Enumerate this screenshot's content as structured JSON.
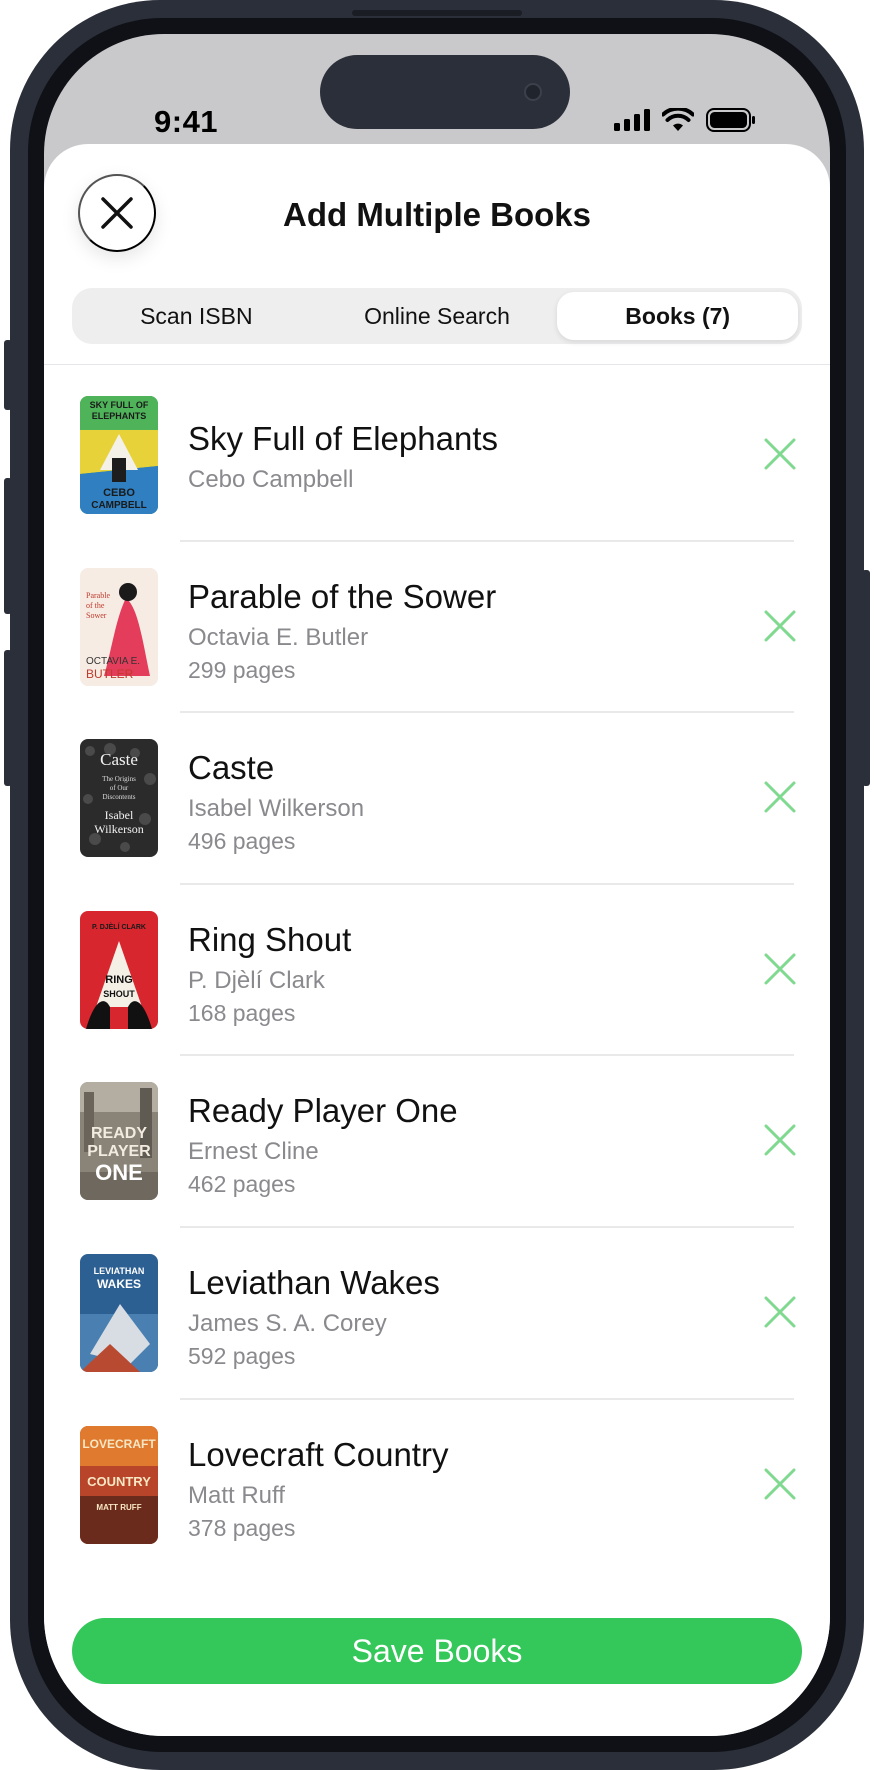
{
  "status_bar": {
    "time": "9:41"
  },
  "sheet": {
    "title": "Add Multiple Books",
    "close_icon": "close-icon"
  },
  "tabs": [
    {
      "label": "Scan ISBN",
      "active": false
    },
    {
      "label": "Online Search",
      "active": false
    },
    {
      "label": "Books (7)",
      "active": true
    }
  ],
  "books": [
    {
      "title": "Sky Full of Elephants",
      "author": "Cebo Campbell",
      "pages": "",
      "cover_text": [
        "SKY FULL OF",
        "ELEPHANTS",
        "CEBO",
        "CAMPBELL"
      ]
    },
    {
      "title": "Parable of the Sower",
      "author": "Octavia E. Butler",
      "pages": "299 pages",
      "cover_text": [
        "Parable",
        "of the",
        "Sower",
        "OCTAVIA E.",
        "BUTLER"
      ]
    },
    {
      "title": "Caste",
      "author": "Isabel Wilkerson",
      "pages": "496 pages",
      "cover_text": [
        "Caste",
        "The Origins",
        "of Our",
        "Discontents",
        "Isabel",
        "Wilkerson"
      ]
    },
    {
      "title": "Ring Shout",
      "author": "P. Djèlí Clark",
      "pages": "168 pages",
      "cover_text": [
        "P. DJÈLÍ CLARK",
        "RING",
        "SHOUT"
      ]
    },
    {
      "title": "Ready Player One",
      "author": "Ernest Cline",
      "pages": "462 pages",
      "cover_text": [
        "READY",
        "PLAYER",
        "ONE"
      ]
    },
    {
      "title": "Leviathan Wakes",
      "author": "James S. A. Corey",
      "pages": "592 pages",
      "cover_text": [
        "LEVIATHAN",
        "WAKES"
      ]
    },
    {
      "title": "Lovecraft Country",
      "author": "Matt Ruff",
      "pages": "378 pages",
      "cover_text": [
        "LOVECRAFT",
        "COUNTRY",
        "MATT RUFF"
      ]
    }
  ],
  "save_button": {
    "label": "Save Books"
  },
  "colors": {
    "accent_green": "#34c759",
    "remove_x": "#7fd98f",
    "frame": "#2b2f39"
  }
}
